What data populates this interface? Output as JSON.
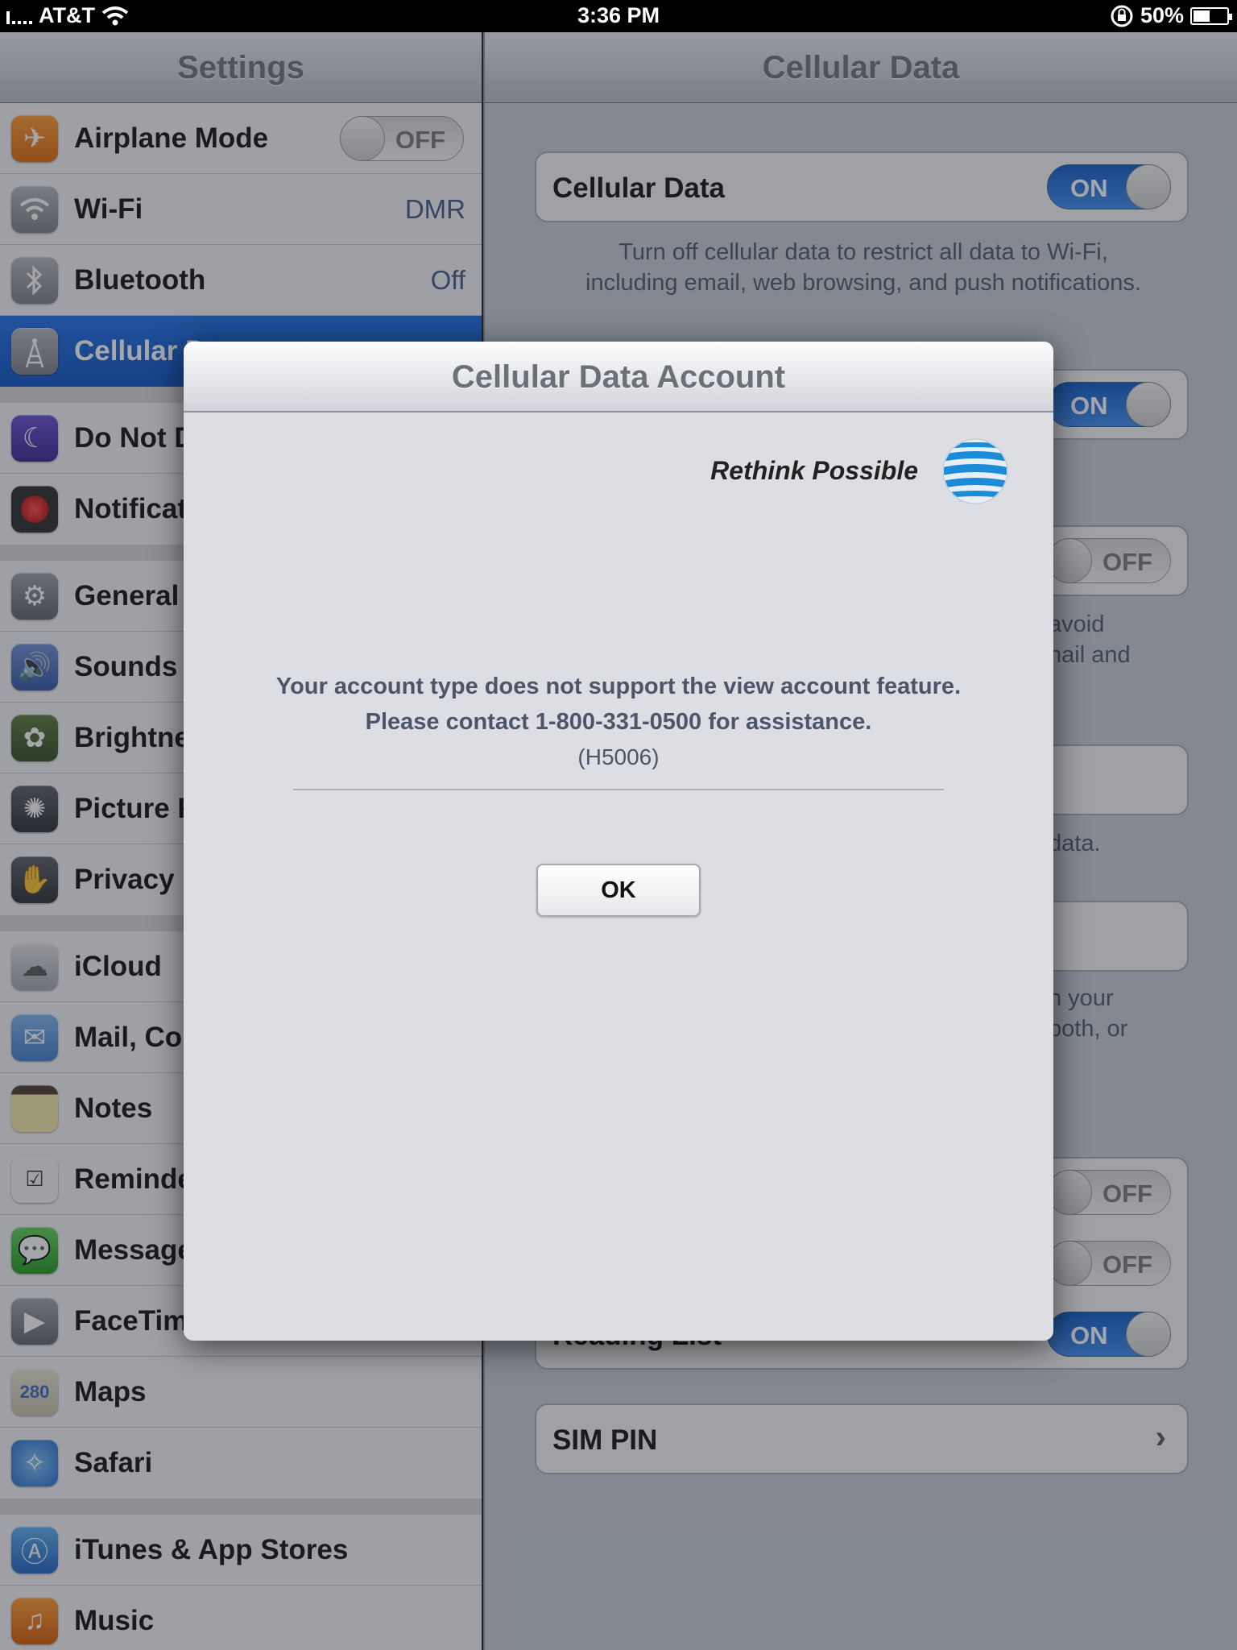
{
  "status_bar": {
    "carrier": "AT&T",
    "time": "3:36 PM",
    "battery_text": "50%",
    "battery_level": 0.5
  },
  "left_pane": {
    "title": "Settings",
    "items": [
      {
        "label": "Airplane Mode",
        "toggle": "OFF",
        "icon": "airplane-icon"
      },
      {
        "label": "Wi-Fi",
        "value": "DMR",
        "icon": "wifi-icon"
      },
      {
        "label": "Bluetooth",
        "value": "Off",
        "icon": "bluetooth-icon"
      },
      {
        "label": "Cellular Data",
        "icon": "cellular-tower-icon",
        "selected": true
      },
      {
        "label": "Do Not Disturb",
        "icon": "moon-icon"
      },
      {
        "label": "Notifications",
        "icon": "notifications-icon"
      },
      {
        "label": "General",
        "icon": "gear-icon"
      },
      {
        "label": "Sounds",
        "icon": "speaker-icon"
      },
      {
        "label": "Brightness & Wallpaper",
        "icon": "flower-icon"
      },
      {
        "label": "Picture Frame",
        "icon": "picture-frame-icon"
      },
      {
        "label": "Privacy",
        "icon": "hand-icon"
      },
      {
        "label": "iCloud",
        "icon": "cloud-icon"
      },
      {
        "label": "Mail, Contacts, Calendars",
        "icon": "mail-icon"
      },
      {
        "label": "Notes",
        "icon": "notes-icon"
      },
      {
        "label": "Reminders",
        "icon": "reminders-icon"
      },
      {
        "label": "Messages",
        "icon": "messages-icon"
      },
      {
        "label": "FaceTime",
        "icon": "facetime-icon"
      },
      {
        "label": "Maps",
        "icon": "maps-icon"
      },
      {
        "label": "Safari",
        "icon": "safari-icon"
      },
      {
        "label": "iTunes & App Stores",
        "icon": "app-store-icon"
      },
      {
        "label": "Music",
        "icon": "music-icon"
      }
    ]
  },
  "right_pane": {
    "title": "Cellular Data",
    "cellular_data_label": "Cellular Data",
    "cellular_data_toggle": "ON",
    "cellular_note": "Turn off cellular data to restrict all data to Wi-Fi, including email, web browsing, and push notifications.",
    "toggle_on": "ON",
    "toggle_off": "OFF",
    "fragment_avoid": "avoid",
    "fragment_mail_and": "nail and",
    "fragment_data": "data.",
    "fragment_your": "n your",
    "fragment_both_or": "both, or",
    "reading_list_label": "Reading List",
    "sim_pin_label": "SIM PIN"
  },
  "modal": {
    "title": "Cellular Data Account",
    "brand_tagline": "Rethink Possible",
    "message_line1": "Your account type does not support the view account feature.",
    "message_line2": "Please contact 1-800-331-0500 for assistance.",
    "message_code": "(H5006)",
    "ok_label": "OK"
  },
  "colors": {
    "selected_row": "#1b6ee6",
    "toggle_on": "#1e73e0",
    "att_blue": "#1a8cd8"
  }
}
